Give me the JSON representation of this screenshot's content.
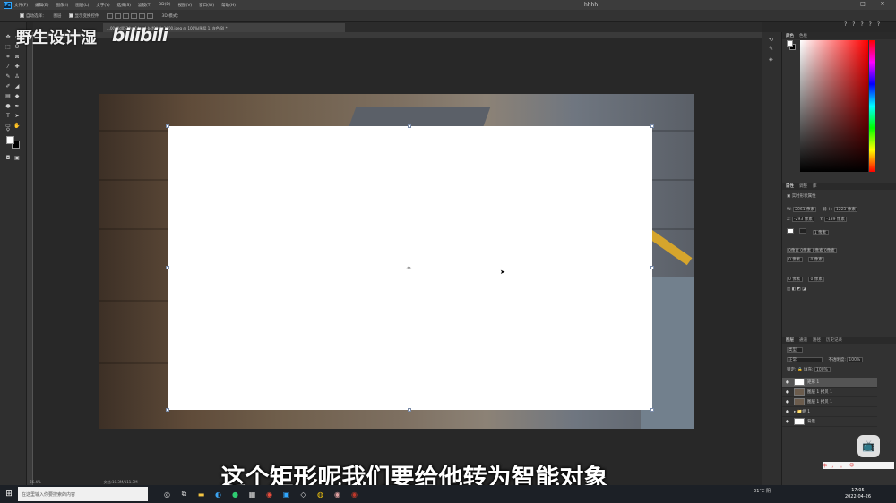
{
  "app": {
    "logo": "Ps",
    "menu": [
      "文件(F)",
      "编辑(E)",
      "图像(I)",
      "图层(L)",
      "文字(Y)",
      "选择(S)",
      "滤镜(T)",
      "3D(D)",
      "视图(V)",
      "窗口(W)",
      "帮助(H)"
    ],
    "window_title": "hhhh",
    "window_controls": [
      "—",
      "□",
      "✕"
    ]
  },
  "options_bar": {
    "auto_select_label": "自动选择：",
    "auto_select_value": "图层",
    "show_transform_label": "显示变换控件",
    "mode_3d_label": "3D 模式：",
    "right_icons": [
      "?",
      "?",
      "?",
      "?",
      "?"
    ]
  },
  "document_tab": {
    "title": "…00d0d0530c614ab4-b4f00_fw1200.jpeg @ 100%(图层 1, 灰色/8) *"
  },
  "watermark": {
    "brand": "野生设计湿",
    "logo": "bilibili"
  },
  "subtitle": "这个矩形呢我们要给他转为智能对象",
  "status_bar": {
    "zoom": "66.4%",
    "doc_info": "文档:10.3M/111.3M"
  },
  "panels": {
    "color_tabs": [
      "颜色",
      "色板"
    ],
    "properties_tabs": [
      "属性",
      "调整",
      "库"
    ],
    "properties_section": "实时形状属性",
    "props": {
      "w_label": "W:",
      "w_value": "2061 像素",
      "h_label": "H:",
      "h_value": "1223 像素",
      "x_label": "X:",
      "x_value": "-293 像素",
      "y_label": "Y:",
      "y_value": "-139 像素",
      "stroke_value": "1 像素",
      "corner_all": "0像素 0像素 0像素 0像素",
      "corner_tl": "0 像素",
      "corner_tr": "0 像素",
      "corner_bl": "0 像素",
      "corner_br": "0 像素"
    },
    "layers_tabs": [
      "图层",
      "通道",
      "路径",
      "历史记录"
    ],
    "blend_mode": "正常",
    "opacity_label": "不透明度:",
    "opacity_value": "100%",
    "fill_label": "填充:",
    "fill_value": "100%",
    "lock_label": "锁定:",
    "kind_filter": "类型",
    "layers": [
      {
        "name": "矩形 1",
        "selected": true
      },
      {
        "name": "图层 1 拷贝 1",
        "selected": false
      },
      {
        "name": "图层 1 拷贝 1",
        "selected": false
      },
      {
        "name": "组 1",
        "selected": false
      },
      {
        "name": "背景",
        "selected": false
      }
    ]
  },
  "taskbar": {
    "search_placeholder": "在这里输入你要搜索的内容",
    "weather": "31°C 阴",
    "time": "17:05",
    "date": "2022-04-26",
    "ime": [
      "中",
      "，",
      "。",
      "☺"
    ]
  },
  "colors": {
    "canvas_bg": "#282828",
    "panel_bg": "#323232",
    "rect_fill": "#ffffff",
    "accent": "#31a8ff"
  }
}
